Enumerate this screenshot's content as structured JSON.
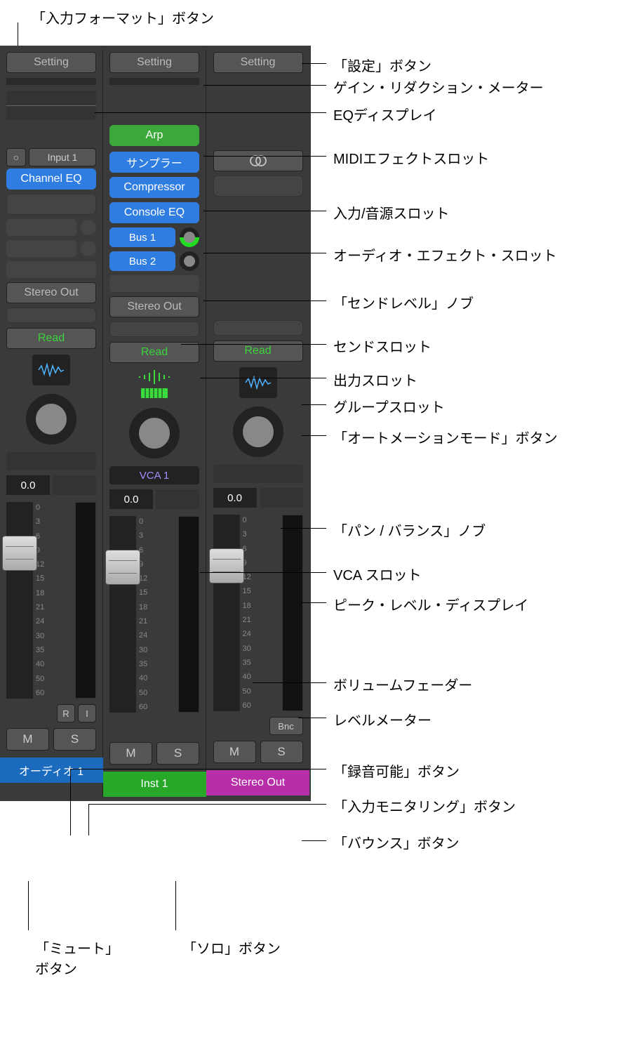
{
  "callouts": {
    "input_format": "「入力フォーマット」ボタン",
    "setting": "「設定」ボタン",
    "gain_reduction": "ゲイン・リダクション・メーター",
    "eq_display": "EQディスプレイ",
    "midi_fx_slot": "MIDIエフェクトスロット",
    "input_instrument_slot": "入力/音源スロット",
    "audio_fx_slot": "オーディオ・エフェクト・スロット",
    "send_level_knob": "「センドレベル」ノブ",
    "send_slot": "センドスロット",
    "output_slot": "出力スロット",
    "group_slot": "グループスロット",
    "automation_mode": "「オートメーションモード」ボタン",
    "pan_balance": "「パン / バランス」ノブ",
    "vca_slot": "VCA スロット",
    "peak_level": "ピーク・レベル・ディスプレイ",
    "volume_fader": "ボリュームフェーダー",
    "level_meter": "レベルメーター",
    "record_enable": "「録音可能」ボタン",
    "input_monitor": "「入力モニタリング」ボタン",
    "bounce": "「バウンス」ボタン",
    "mute": "「ミュート」\nボタン",
    "solo": "「ソロ」ボタン"
  },
  "strips": [
    {
      "setting": "Setting",
      "input_format": "○",
      "input_label": "Input 1",
      "fx": [
        "Channel EQ"
      ],
      "output": "Stereo Out",
      "read": "Read",
      "peak": "0.0",
      "record": "R",
      "input_mon": "I",
      "mute": "M",
      "solo": "S",
      "name": "オーディオ 1",
      "name_color": "name-blue"
    },
    {
      "setting": "Setting",
      "midi_fx": "Arp",
      "instrument": "サンプラー",
      "fx": [
        "Compressor",
        "Console EQ"
      ],
      "sends": [
        "Bus 1",
        "Bus 2"
      ],
      "output": "Stereo Out",
      "read": "Read",
      "vca": "VCA 1",
      "peak": "0.0",
      "mute": "M",
      "solo": "S",
      "name": "Inst 1",
      "name_color": "name-green"
    },
    {
      "setting": "Setting",
      "stereo_icon": "◎",
      "read": "Read",
      "peak": "0.0",
      "bnc": "Bnc",
      "mute": "M",
      "solo": "S",
      "name": "Stereo Out",
      "name_color": "name-mag"
    }
  ],
  "fader_scale": [
    "0",
    "3",
    "6",
    "9",
    "12",
    "15",
    "18",
    "21",
    "24",
    "30",
    "35",
    "40",
    "50",
    "60"
  ]
}
